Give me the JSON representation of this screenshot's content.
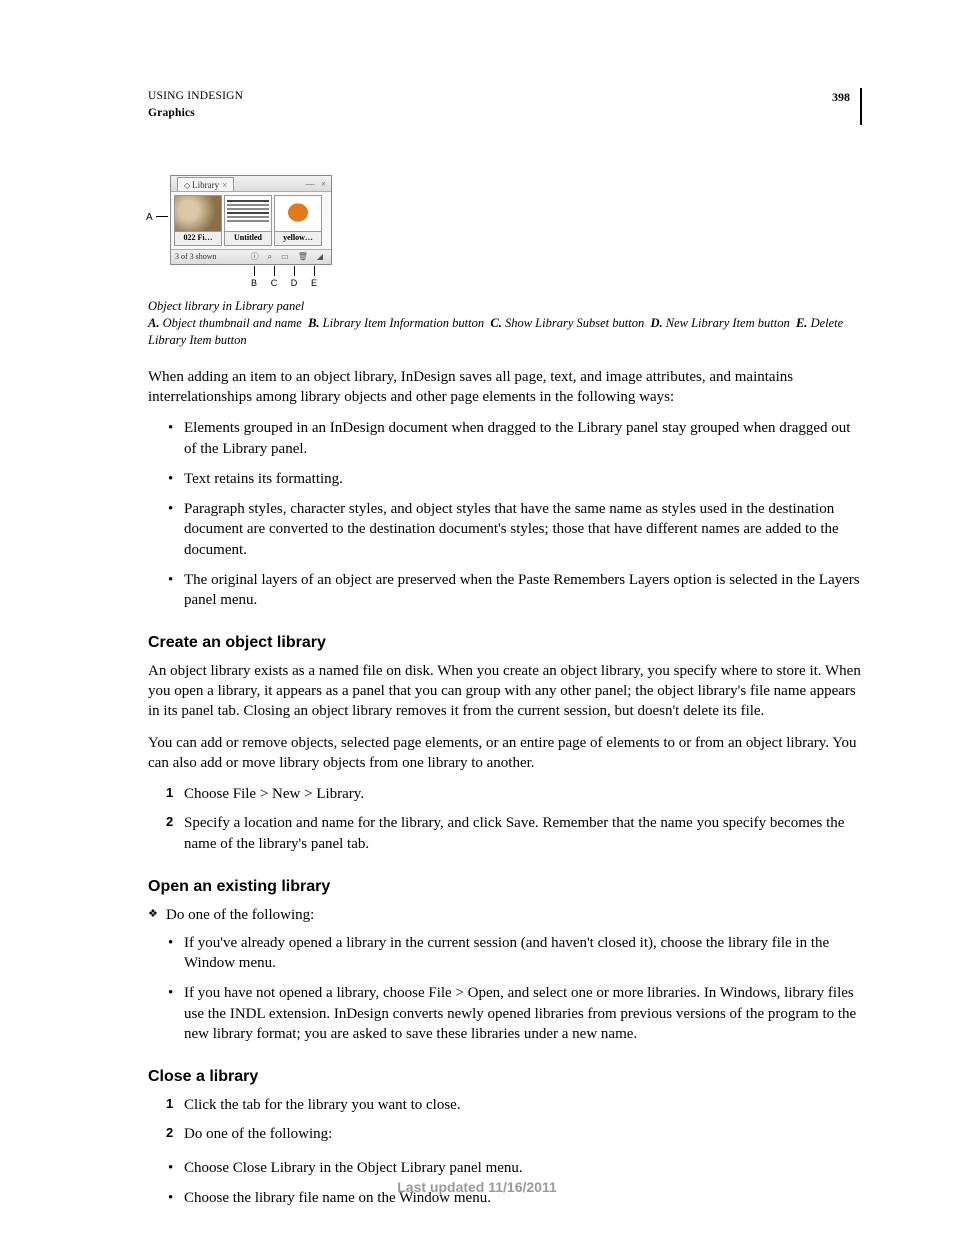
{
  "header": {
    "chapter": "USING INDESIGN",
    "section": "Graphics",
    "page": "398"
  },
  "figure": {
    "callout_a": "A",
    "panel_tab": "Library",
    "thumbs": [
      {
        "label": "022 Fi…"
      },
      {
        "label": "Untitled"
      },
      {
        "label": "yellow…"
      }
    ],
    "status": "3 of 3 shown",
    "callouts": [
      {
        "letter": "B"
      },
      {
        "letter": "C"
      },
      {
        "letter": "D"
      },
      {
        "letter": "E"
      }
    ]
  },
  "caption": {
    "title": "Object library in Library panel",
    "a_b": "A.",
    "a_t": "Object thumbnail and name",
    "b_b": "B.",
    "b_t": "Library Item Information button",
    "c_b": "C.",
    "c_t": "Show Library Subset button",
    "d_b": "D.",
    "d_t": "New Library Item button",
    "e_b": "E.",
    "e_t": "Delete Library Item button"
  },
  "intro": "When adding an item to an object library, InDesign saves all page, text, and image attributes, and maintains interrelationships among library objects and other page elements in the following ways:",
  "bullets1": [
    "Elements grouped in an InDesign document when dragged to the Library panel stay grouped when dragged out of the Library panel.",
    "Text retains its formatting.",
    "Paragraph styles, character styles, and object styles that have the same name as styles used in the destination document are converted to the destination document's styles; those that have different names are added to the document.",
    "The original layers of an object are preserved when the Paste Remembers Layers option is selected in the Layers panel menu."
  ],
  "h_create": "Create an object library",
  "create_p1": "An object library exists as a named file on disk. When you create an object library, you specify where to store it. When you open a library, it appears as a panel that you can group with any other panel; the object library's file name appears in its panel tab. Closing an object library removes it from the current session, but doesn't delete its file.",
  "create_p2": "You can add or remove objects, selected page elements, or an entire page of elements to or from an object library. You can also add or move library objects from one library to another.",
  "create_steps": [
    "Choose File > New > Library.",
    "Specify a location and name for the library, and click Save. Remember that the name you specify becomes the name of the library's panel tab."
  ],
  "h_open": "Open an existing library",
  "open_lead": "Do one of the following:",
  "open_bullets": [
    "If you've already opened a library in the current session (and haven't closed it), choose the library file in the Window menu.",
    "If you have not opened a library, choose File > Open, and select one or more libraries. In Windows, library files use the INDL extension. InDesign converts newly opened libraries from previous versions of the program to the new library format; you are asked to save these libraries under a new name."
  ],
  "h_close": "Close a library",
  "close_steps": [
    "Click the tab for the library you want to close.",
    "Do one of the following:"
  ],
  "close_bullets": [
    "Choose Close Library in the Object Library panel menu.",
    "Choose the library file name on the Window menu."
  ],
  "footer": "Last updated 11/16/2011"
}
